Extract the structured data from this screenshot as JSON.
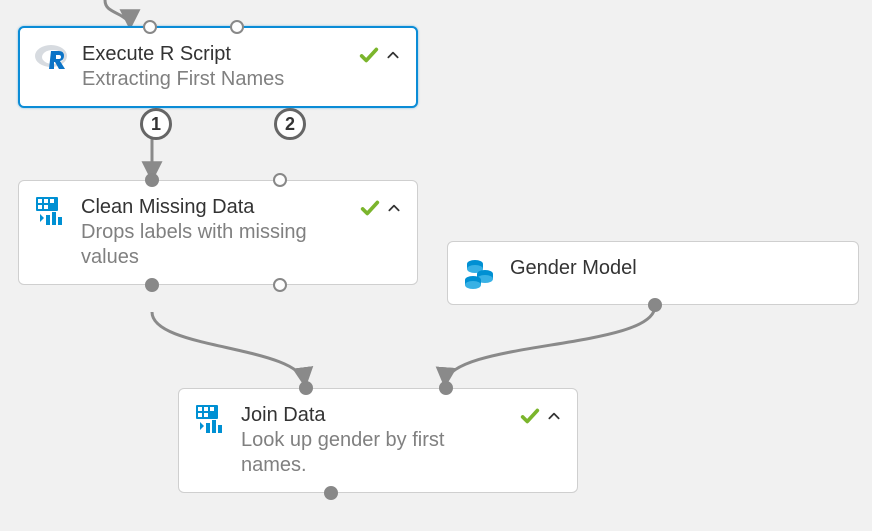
{
  "nodes": {
    "execute_r": {
      "title": "Execute R Script",
      "subtitle": "Extracting First Names",
      "icon": "r-logo-icon",
      "status": "complete",
      "out_port_labels": [
        "1",
        "2"
      ]
    },
    "clean_missing": {
      "title": "Clean Missing Data",
      "subtitle": "Drops labels with missing values",
      "icon": "data-table-icon",
      "status": "complete"
    },
    "gender_model": {
      "title": "Gender Model",
      "subtitle": "",
      "icon": "dataset-icon",
      "status": "none"
    },
    "join_data": {
      "title": "Join Data",
      "subtitle": "Look up gender by first names.",
      "icon": "data-table-icon",
      "status": "complete"
    }
  },
  "colors": {
    "selected_border": "#0b8cd6",
    "accent_blue": "#0090d3",
    "check_green": "#7bb52c",
    "edge_gray": "#8a8a8a"
  }
}
